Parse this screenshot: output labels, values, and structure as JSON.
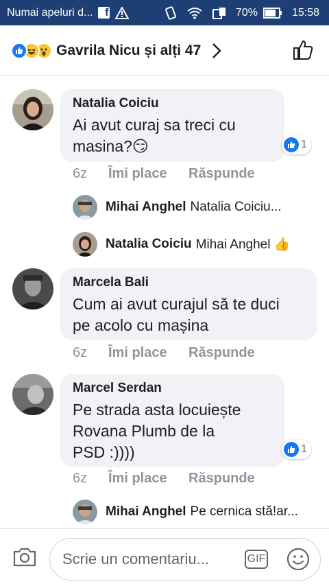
{
  "status_bar": {
    "carrier": "Numai apeluri d...",
    "battery": "70%",
    "time": "15:58"
  },
  "header": {
    "title": "Gavrila Nicu și alți 47",
    "reaction_icons": [
      "like-icon",
      "haha-icon",
      "wow-icon"
    ]
  },
  "comments": [
    {
      "author": "Natalia Coiciu",
      "lines": [
        "Ai avut curaj sa treci cu",
        "masina?😏"
      ],
      "time": "6z",
      "like_label": "Îmi place",
      "reply_label": "Răspunde",
      "reaction_count": "1",
      "replies": [
        {
          "author": "Mihai Anghel",
          "text": "Natalia Coiciu..."
        },
        {
          "author": "Natalia Coiciu",
          "text": "Mihai Anghel 👍"
        }
      ]
    },
    {
      "author": "Marcela Bali",
      "lines": [
        "Cum ai avut curajul să te duci",
        "pe acolo cu mașina"
      ],
      "time": "6z",
      "like_label": "Îmi place",
      "reply_label": "Răspunde"
    },
    {
      "author": "Marcel Serdan",
      "lines": [
        "Pe strada asta locuiește",
        "Rovana Plumb de la",
        "PSD :))))"
      ],
      "time": "6z",
      "like_label": "Îmi place",
      "reply_label": "Răspunde",
      "reaction_count": "1",
      "replies": [
        {
          "author": "Mihai Anghel",
          "text": "Pe cernica stă!ar..."
        }
      ]
    }
  ],
  "composer": {
    "placeholder": "Scrie un comentariu...",
    "gif_label": "GIF"
  },
  "colors": {
    "status_bar": "#1d3f73",
    "bubble": "#f0f2f5",
    "like_blue": "#1877f2",
    "muted": "#90949c"
  }
}
